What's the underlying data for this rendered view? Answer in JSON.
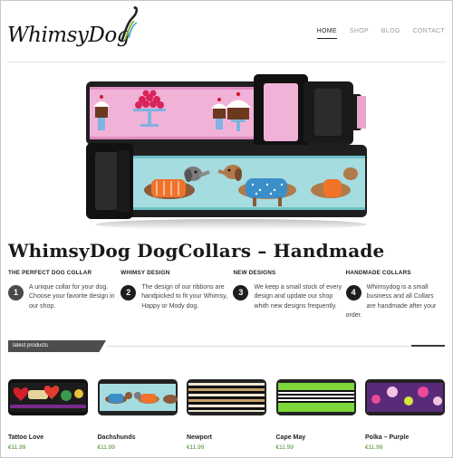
{
  "header": {
    "logo_text": "WhimsyDog",
    "nav": [
      "HOME",
      "SHOP",
      "BLOG",
      "CONTACT"
    ]
  },
  "hero": {
    "alt": "Dog collars with cupcake and dachshund ribbons"
  },
  "page_title": "WhimsyDog DogCollars – Handmade",
  "features": [
    {
      "number": "1",
      "heading": "THE PERFECT DOG COLLAR",
      "body": "A unique collar for your dog. Choose your favorite design in our shop."
    },
    {
      "number": "2",
      "heading": "WHIMSY DESIGN",
      "body": "The design of our ribbons are handpicked to fit your Whimsy, Happy or Mody dog."
    },
    {
      "number": "3",
      "heading": "NEW DESIGNS",
      "body": "We keep a small stock of every design and update our shop whith new designs frequently."
    },
    {
      "number": "4",
      "heading": "HANDMADE COLLARS",
      "body": "Whimsydog is a small business and all Collars are handmade after your order."
    }
  ],
  "latest_label": "latest products",
  "products": [
    {
      "name": "Tattoo Love",
      "price": "€11.99"
    },
    {
      "name": "Dachshunds",
      "price": "€11.99"
    },
    {
      "name": "Newport",
      "price": "€11.99"
    },
    {
      "name": "Cape May",
      "price": "€11.99"
    },
    {
      "name": "Polka – Purple",
      "price": "€11.99"
    }
  ],
  "colors": {
    "accent_green": "#4a8a2c",
    "dark": "#1d1d1d",
    "nav_inactive": "#9a9a9a"
  }
}
